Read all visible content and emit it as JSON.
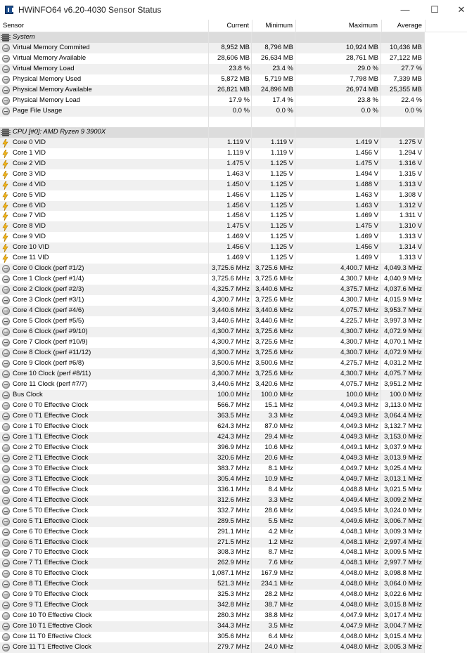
{
  "window": {
    "title": "HWiNFO64 v6.20-4030 Sensor Status",
    "minimize_glyph": "—",
    "maximize_glyph": "☐",
    "close_glyph": "✕"
  },
  "columns": {
    "sensor": "Sensor",
    "current": "Current",
    "minimum": "Minimum",
    "maximum": "Maximum",
    "average": "Average"
  },
  "icons": {
    "metric": "sensor-circle-icon",
    "voltage": "lightning-bolt-icon",
    "group": "chip-icon"
  },
  "rows": [
    {
      "type": "group",
      "name": "System"
    },
    {
      "type": "metric",
      "name": "Virtual Memory Commited",
      "cur": "8,952 MB",
      "min": "8,796 MB",
      "max": "10,924 MB",
      "avg": "10,436 MB"
    },
    {
      "type": "metric",
      "name": "Virtual Memory Available",
      "cur": "28,606 MB",
      "min": "26,634 MB",
      "max": "28,761 MB",
      "avg": "27,122 MB"
    },
    {
      "type": "metric",
      "name": "Virtual Memory Load",
      "cur": "23.8 %",
      "min": "23.4 %",
      "max": "29.0 %",
      "avg": "27.7 %"
    },
    {
      "type": "metric",
      "name": "Physical Memory Used",
      "cur": "5,872 MB",
      "min": "5,719 MB",
      "max": "7,798 MB",
      "avg": "7,339 MB"
    },
    {
      "type": "metric",
      "name": "Physical Memory Available",
      "cur": "26,821 MB",
      "min": "24,896 MB",
      "max": "26,974 MB",
      "avg": "25,355 MB"
    },
    {
      "type": "metric",
      "name": "Physical Memory Load",
      "cur": "17.9 %",
      "min": "17.4 %",
      "max": "23.8 %",
      "avg": "22.4 %"
    },
    {
      "type": "metric",
      "name": "Page File Usage",
      "cur": "0.0 %",
      "min": "0.0 %",
      "max": "0.0 %",
      "avg": "0.0 %"
    },
    {
      "type": "blank",
      "name": ""
    },
    {
      "type": "group",
      "name": "CPU [#0]: AMD Ryzen 9 3900X"
    },
    {
      "type": "voltage",
      "name": "Core 0 VID",
      "cur": "1.119 V",
      "min": "1.119 V",
      "max": "1.419 V",
      "avg": "1.275 V"
    },
    {
      "type": "voltage",
      "name": "Core 1 VID",
      "cur": "1.119 V",
      "min": "1.119 V",
      "max": "1.456 V",
      "avg": "1.294 V"
    },
    {
      "type": "voltage",
      "name": "Core 2 VID",
      "cur": "1.475 V",
      "min": "1.125 V",
      "max": "1.475 V",
      "avg": "1.316 V"
    },
    {
      "type": "voltage",
      "name": "Core 3 VID",
      "cur": "1.463 V",
      "min": "1.125 V",
      "max": "1.494 V",
      "avg": "1.315 V"
    },
    {
      "type": "voltage",
      "name": "Core 4 VID",
      "cur": "1.450 V",
      "min": "1.125 V",
      "max": "1.488 V",
      "avg": "1.313 V"
    },
    {
      "type": "voltage",
      "name": "Core 5 VID",
      "cur": "1.456 V",
      "min": "1.125 V",
      "max": "1.463 V",
      "avg": "1.308 V"
    },
    {
      "type": "voltage",
      "name": "Core 6 VID",
      "cur": "1.456 V",
      "min": "1.125 V",
      "max": "1.463 V",
      "avg": "1.312 V"
    },
    {
      "type": "voltage",
      "name": "Core 7 VID",
      "cur": "1.456 V",
      "min": "1.125 V",
      "max": "1.469 V",
      "avg": "1.311 V"
    },
    {
      "type": "voltage",
      "name": "Core 8 VID",
      "cur": "1.475 V",
      "min": "1.125 V",
      "max": "1.475 V",
      "avg": "1.310 V"
    },
    {
      "type": "voltage",
      "name": "Core 9 VID",
      "cur": "1.469 V",
      "min": "1.125 V",
      "max": "1.469 V",
      "avg": "1.313 V"
    },
    {
      "type": "voltage",
      "name": "Core 10 VID",
      "cur": "1.456 V",
      "min": "1.125 V",
      "max": "1.456 V",
      "avg": "1.314 V"
    },
    {
      "type": "voltage",
      "name": "Core 11 VID",
      "cur": "1.469 V",
      "min": "1.125 V",
      "max": "1.469 V",
      "avg": "1.313 V"
    },
    {
      "type": "metric",
      "name": "Core 0 Clock (perf #1/2)",
      "cur": "3,725.6 MHz",
      "min": "3,725.6 MHz",
      "max": "4,400.7 MHz",
      "avg": "4,049.3 MHz"
    },
    {
      "type": "metric",
      "name": "Core 1 Clock (perf #1/4)",
      "cur": "3,725.6 MHz",
      "min": "3,725.6 MHz",
      "max": "4,300.7 MHz",
      "avg": "4,040.9 MHz"
    },
    {
      "type": "metric",
      "name": "Core 2 Clock (perf #2/3)",
      "cur": "4,325.7 MHz",
      "min": "3,440.6 MHz",
      "max": "4,375.7 MHz",
      "avg": "4,037.6 MHz"
    },
    {
      "type": "metric",
      "name": "Core 3 Clock (perf #3/1)",
      "cur": "4,300.7 MHz",
      "min": "3,725.6 MHz",
      "max": "4,300.7 MHz",
      "avg": "4,015.9 MHz"
    },
    {
      "type": "metric",
      "name": "Core 4 Clock (perf #4/6)",
      "cur": "3,440.6 MHz",
      "min": "3,440.6 MHz",
      "max": "4,075.7 MHz",
      "avg": "3,953.7 MHz"
    },
    {
      "type": "metric",
      "name": "Core 5 Clock (perf #5/5)",
      "cur": "3,440.6 MHz",
      "min": "3,440.6 MHz",
      "max": "4,225.7 MHz",
      "avg": "3,997.3 MHz"
    },
    {
      "type": "metric",
      "name": "Core 6 Clock (perf #9/10)",
      "cur": "4,300.7 MHz",
      "min": "3,725.6 MHz",
      "max": "4,300.7 MHz",
      "avg": "4,072.9 MHz"
    },
    {
      "type": "metric",
      "name": "Core 7 Clock (perf #10/9)",
      "cur": "4,300.7 MHz",
      "min": "3,725.6 MHz",
      "max": "4,300.7 MHz",
      "avg": "4,070.1 MHz"
    },
    {
      "type": "metric",
      "name": "Core 8 Clock (perf #11/12)",
      "cur": "4,300.7 MHz",
      "min": "3,725.6 MHz",
      "max": "4,300.7 MHz",
      "avg": "4,072.9 MHz"
    },
    {
      "type": "metric",
      "name": "Core 9 Clock (perf #6/8)",
      "cur": "3,500.6 MHz",
      "min": "3,500.6 MHz",
      "max": "4,275.7 MHz",
      "avg": "4,031.2 MHz"
    },
    {
      "type": "metric",
      "name": "Core 10 Clock (perf #8/11)",
      "cur": "4,300.7 MHz",
      "min": "3,725.6 MHz",
      "max": "4,300.7 MHz",
      "avg": "4,075.7 MHz"
    },
    {
      "type": "metric",
      "name": "Core 11 Clock (perf #7/7)",
      "cur": "3,440.6 MHz",
      "min": "3,420.6 MHz",
      "max": "4,075.7 MHz",
      "avg": "3,951.2 MHz"
    },
    {
      "type": "metric",
      "name": "Bus Clock",
      "cur": "100.0 MHz",
      "min": "100.0 MHz",
      "max": "100.0 MHz",
      "avg": "100.0 MHz"
    },
    {
      "type": "metric",
      "name": "Core 0 T0 Effective Clock",
      "cur": "566.7 MHz",
      "min": "15.1 MHz",
      "max": "4,049.3 MHz",
      "avg": "3,113.0 MHz"
    },
    {
      "type": "metric",
      "name": "Core 0 T1 Effective Clock",
      "cur": "363.5 MHz",
      "min": "3.3 MHz",
      "max": "4,049.3 MHz",
      "avg": "3,064.4 MHz"
    },
    {
      "type": "metric",
      "name": "Core 1 T0 Effective Clock",
      "cur": "624.3 MHz",
      "min": "87.0 MHz",
      "max": "4,049.3 MHz",
      "avg": "3,132.7 MHz"
    },
    {
      "type": "metric",
      "name": "Core 1 T1 Effective Clock",
      "cur": "424.3 MHz",
      "min": "29.4 MHz",
      "max": "4,049.3 MHz",
      "avg": "3,153.0 MHz"
    },
    {
      "type": "metric",
      "name": "Core 2 T0 Effective Clock",
      "cur": "396.9 MHz",
      "min": "10.6 MHz",
      "max": "4,049.1 MHz",
      "avg": "3,037.9 MHz"
    },
    {
      "type": "metric",
      "name": "Core 2 T1 Effective Clock",
      "cur": "320.6 MHz",
      "min": "20.6 MHz",
      "max": "4,049.3 MHz",
      "avg": "3,013.9 MHz"
    },
    {
      "type": "metric",
      "name": "Core 3 T0 Effective Clock",
      "cur": "383.7 MHz",
      "min": "8.1 MHz",
      "max": "4,049.7 MHz",
      "avg": "3,025.4 MHz"
    },
    {
      "type": "metric",
      "name": "Core 3 T1 Effective Clock",
      "cur": "305.4 MHz",
      "min": "10.9 MHz",
      "max": "4,049.7 MHz",
      "avg": "3,013.1 MHz"
    },
    {
      "type": "metric",
      "name": "Core 4 T0 Effective Clock",
      "cur": "336.1 MHz",
      "min": "8.4 MHz",
      "max": "4,048.8 MHz",
      "avg": "3,021.5 MHz"
    },
    {
      "type": "metric",
      "name": "Core 4 T1 Effective Clock",
      "cur": "312.6 MHz",
      "min": "3.3 MHz",
      "max": "4,049.4 MHz",
      "avg": "3,009.2 MHz"
    },
    {
      "type": "metric",
      "name": "Core 5 T0 Effective Clock",
      "cur": "332.7 MHz",
      "min": "28.6 MHz",
      "max": "4,049.5 MHz",
      "avg": "3,024.0 MHz"
    },
    {
      "type": "metric",
      "name": "Core 5 T1 Effective Clock",
      "cur": "289.5 MHz",
      "min": "5.5 MHz",
      "max": "4,049.6 MHz",
      "avg": "3,006.7 MHz"
    },
    {
      "type": "metric",
      "name": "Core 6 T0 Effective Clock",
      "cur": "291.1 MHz",
      "min": "4.2 MHz",
      "max": "4,048.1 MHz",
      "avg": "3,009.3 MHz"
    },
    {
      "type": "metric",
      "name": "Core 6 T1 Effective Clock",
      "cur": "271.5 MHz",
      "min": "1.2 MHz",
      "max": "4,048.1 MHz",
      "avg": "2,997.4 MHz"
    },
    {
      "type": "metric",
      "name": "Core 7 T0 Effective Clock",
      "cur": "308.3 MHz",
      "min": "8.7 MHz",
      "max": "4,048.1 MHz",
      "avg": "3,009.5 MHz"
    },
    {
      "type": "metric",
      "name": "Core 7 T1 Effective Clock",
      "cur": "262.9 MHz",
      "min": "7.6 MHz",
      "max": "4,048.1 MHz",
      "avg": "2,997.7 MHz"
    },
    {
      "type": "metric",
      "name": "Core 8 T0 Effective Clock",
      "cur": "1,087.1 MHz",
      "min": "167.9 MHz",
      "max": "4,048.0 MHz",
      "avg": "3,098.8 MHz"
    },
    {
      "type": "metric",
      "name": "Core 8 T1 Effective Clock",
      "cur": "521.3 MHz",
      "min": "234.1 MHz",
      "max": "4,048.0 MHz",
      "avg": "3,064.0 MHz"
    },
    {
      "type": "metric",
      "name": "Core 9 T0 Effective Clock",
      "cur": "325.3 MHz",
      "min": "28.2 MHz",
      "max": "4,048.0 MHz",
      "avg": "3,022.6 MHz"
    },
    {
      "type": "metric",
      "name": "Core 9 T1 Effective Clock",
      "cur": "342.8 MHz",
      "min": "38.7 MHz",
      "max": "4,048.0 MHz",
      "avg": "3,015.8 MHz"
    },
    {
      "type": "metric",
      "name": "Core 10 T0 Effective Clock",
      "cur": "280.3 MHz",
      "min": "38.8 MHz",
      "max": "4,047.9 MHz",
      "avg": "3,017.4 MHz"
    },
    {
      "type": "metric",
      "name": "Core 10 T1 Effective Clock",
      "cur": "344.3 MHz",
      "min": "3.5 MHz",
      "max": "4,047.9 MHz",
      "avg": "3,004.7 MHz"
    },
    {
      "type": "metric",
      "name": "Core 11 T0 Effective Clock",
      "cur": "305.6 MHz",
      "min": "6.4 MHz",
      "max": "4,048.0 MHz",
      "avg": "3,015.4 MHz"
    },
    {
      "type": "metric",
      "name": "Core 11 T1 Effective Clock",
      "cur": "279.7 MHz",
      "min": "24.0 MHz",
      "max": "4,048.0 MHz",
      "avg": "3,005.3 MHz"
    }
  ]
}
